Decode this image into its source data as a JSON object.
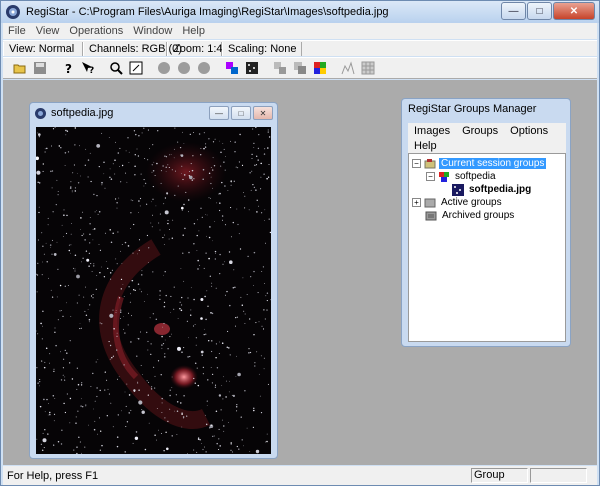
{
  "window": {
    "title": "RegiStar - C:\\Program Files\\Auriga Imaging\\RegiStar\\Images\\softpedia.jpg"
  },
  "menu": [
    "File",
    "View",
    "Operations",
    "Window",
    "Help"
  ],
  "info": {
    "view": "View: Normal",
    "channels": "Channels: RGB (0)",
    "zoom": "Zoom: 1:4",
    "scaling": "Scaling: None"
  },
  "toolbar": {
    "icons": [
      "open-icon",
      "save-icon",
      "help-icon",
      "context-help-icon",
      "zoom-icon",
      "fit-icon",
      "circle1-icon",
      "circle2-icon",
      "circle3-icon",
      "register-icon",
      "combine-icon",
      "align-icon",
      "stack-icon",
      "blend-icon",
      "histogram-icon",
      "grid-icon"
    ]
  },
  "image_window": {
    "title": "softpedia.jpg"
  },
  "groups_manager": {
    "title": "RegiStar Groups Manager",
    "menu_row1": [
      "Images",
      "Groups",
      "Options"
    ],
    "menu_row2": [
      "Help"
    ],
    "tree": {
      "current": "Current session groups",
      "group": "softpedia",
      "image": "softpedia.jpg",
      "active": "Active groups",
      "archived": "Archived groups"
    }
  },
  "status": {
    "help": "For Help, press F1",
    "group": "Group"
  },
  "colors": {
    "selection": "#3399ff",
    "client_bg": "#ababab"
  }
}
